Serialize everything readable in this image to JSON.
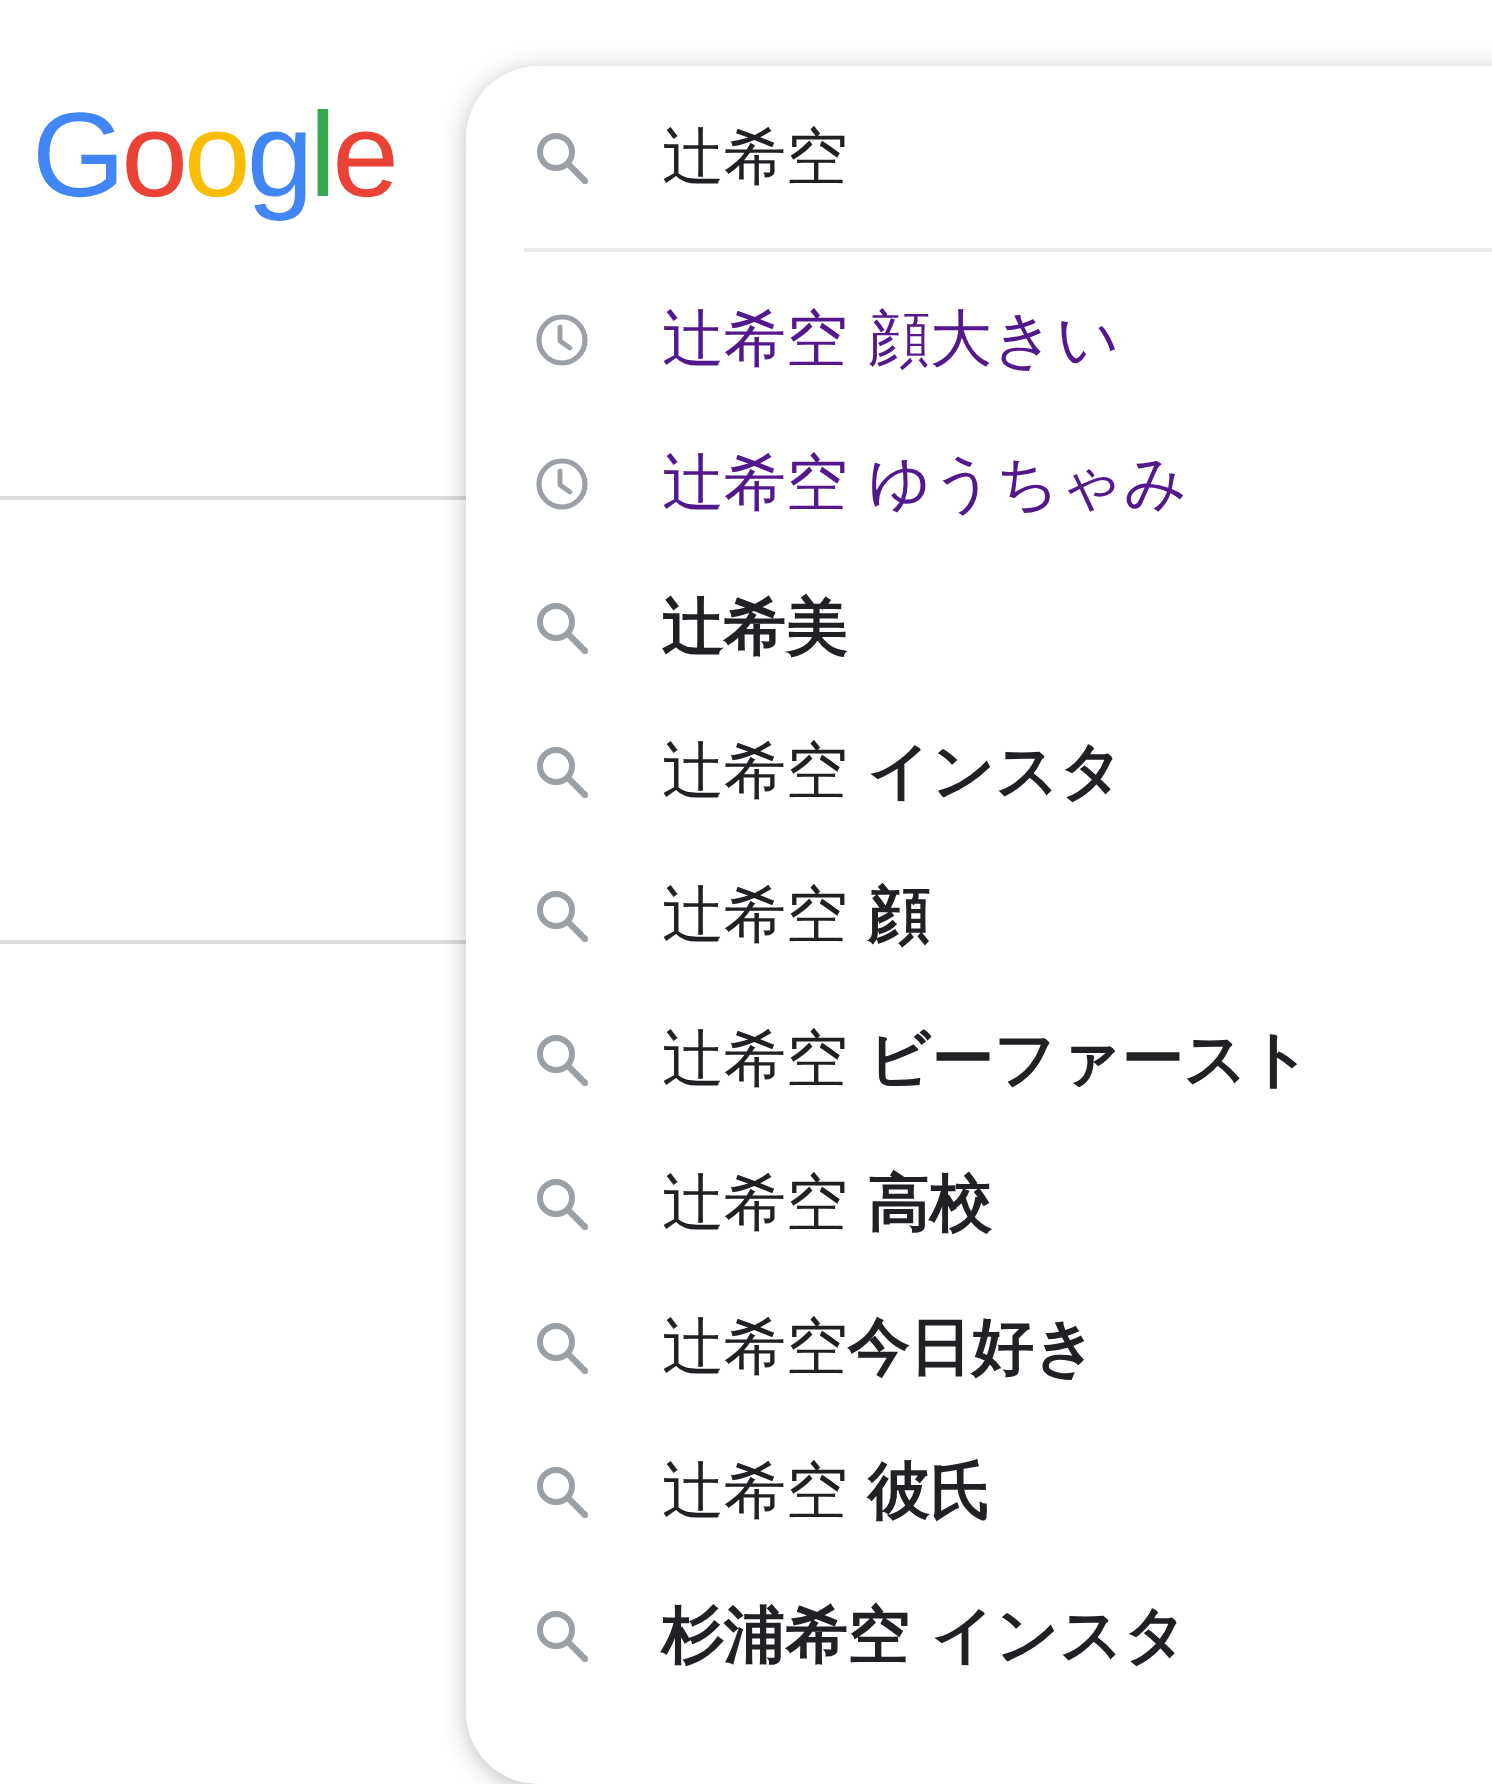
{
  "logo": "Google",
  "search": {
    "value": "辻希空"
  },
  "suggestions": [
    {
      "kind": "history",
      "text": "辻希空 顔大きい",
      "bold": false
    },
    {
      "kind": "history",
      "text": "辻希空 ゆうちゃみ",
      "bold": false
    },
    {
      "kind": "query",
      "text": "辻希美",
      "bold": true
    },
    {
      "kind": "query",
      "text": "辻希空 **インスタ**",
      "bold": false
    },
    {
      "kind": "query",
      "text": "辻希空 **顔**",
      "bold": false
    },
    {
      "kind": "query",
      "text": "辻希空 **ビーファースト**",
      "bold": false
    },
    {
      "kind": "query",
      "text": "辻希空 **高校**",
      "bold": false
    },
    {
      "kind": "query",
      "text": "辻希空**今日好き**",
      "bold": false
    },
    {
      "kind": "query",
      "text": "辻希空 **彼氏**",
      "bold": false
    },
    {
      "kind": "query",
      "text": "杉浦希空 インスタ",
      "bold": true
    }
  ]
}
